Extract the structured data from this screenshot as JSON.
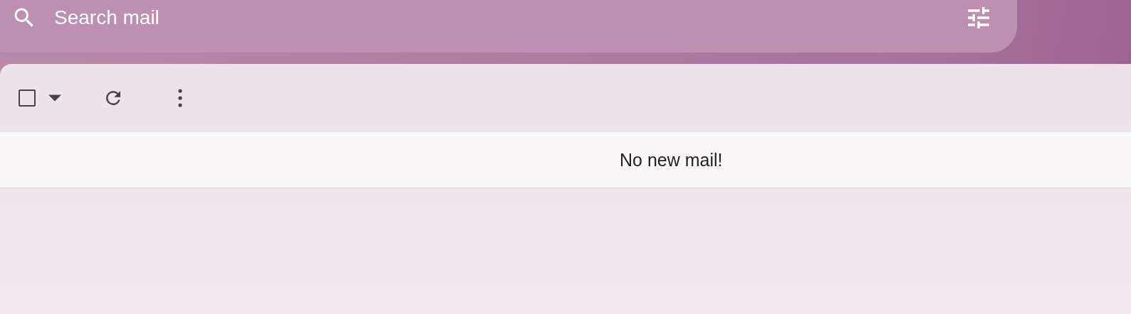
{
  "search": {
    "placeholder": "Search mail"
  },
  "toolbar": {
    "select_all": {
      "checked": false
    }
  },
  "message_list": {
    "empty_message": "No new mail!"
  }
}
